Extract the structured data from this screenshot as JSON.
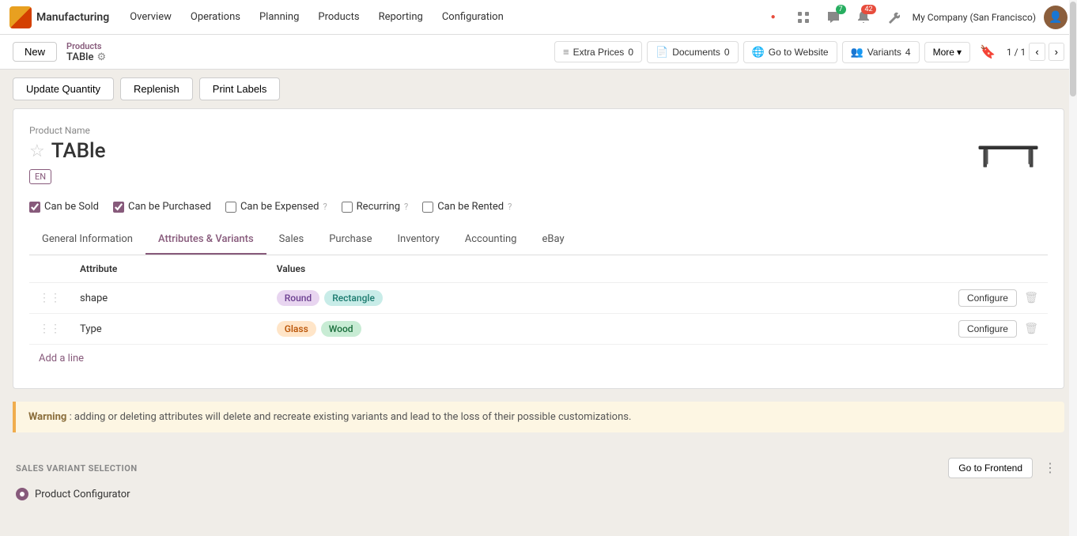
{
  "app": {
    "name": "Manufacturing"
  },
  "topnav": {
    "items": [
      "Overview",
      "Operations",
      "Planning",
      "Products",
      "Reporting",
      "Configuration"
    ],
    "company": "My Company (San Francisco)",
    "notifications": {
      "dot_red": true,
      "chat_count": "7",
      "bell_count": "42"
    }
  },
  "breadcrumb": {
    "new_label": "New",
    "parent": "Products",
    "current": "TABle"
  },
  "toolbar": {
    "extra_prices_label": "Extra Prices",
    "extra_prices_count": "0",
    "documents_label": "Documents",
    "documents_count": "0",
    "go_to_website_label": "Go to Website",
    "variants_label": "Variants",
    "variants_count": "4",
    "more_label": "More",
    "pager": "1 / 1"
  },
  "actions": {
    "update_quantity": "Update Quantity",
    "replenish": "Replenish",
    "print_labels": "Print Labels"
  },
  "product": {
    "label": "Product Name",
    "name": "TABle",
    "lang": "EN"
  },
  "checkboxes": {
    "can_be_sold": "Can be Sold",
    "can_be_sold_checked": true,
    "can_be_purchased": "Can be Purchased",
    "can_be_purchased_checked": true,
    "can_be_expensed": "Can be Expensed",
    "can_be_expensed_checked": false,
    "recurring": "Recurring",
    "recurring_checked": false,
    "can_be_rented": "Can be Rented",
    "can_be_rented_checked": false
  },
  "tabs": [
    {
      "id": "general",
      "label": "General Information"
    },
    {
      "id": "attributes",
      "label": "Attributes & Variants",
      "active": true
    },
    {
      "id": "sales",
      "label": "Sales"
    },
    {
      "id": "purchase",
      "label": "Purchase"
    },
    {
      "id": "inventory",
      "label": "Inventory"
    },
    {
      "id": "accounting",
      "label": "Accounting"
    },
    {
      "id": "ebay",
      "label": "eBay"
    }
  ],
  "attributes_table": {
    "col_attribute": "Attribute",
    "col_values": "Values",
    "rows": [
      {
        "attribute": "shape",
        "values": [
          {
            "label": "Round",
            "color_class": "tag-purple"
          },
          {
            "label": "Rectangle",
            "color_class": "tag-teal"
          }
        ]
      },
      {
        "attribute": "Type",
        "values": [
          {
            "label": "Glass",
            "color_class": "tag-orange"
          },
          {
            "label": "Wood",
            "color_class": "tag-green"
          }
        ]
      }
    ],
    "add_line": "Add a line",
    "configure_label": "Configure"
  },
  "warning": {
    "bold": "Warning",
    "text": ": adding or deleting attributes will delete and recreate existing variants and lead to the loss of their possible customizations."
  },
  "sales_variant": {
    "title": "SALES VARIANT SELECTION",
    "go_frontend": "Go to Frontend",
    "option": "Product Configurator"
  }
}
